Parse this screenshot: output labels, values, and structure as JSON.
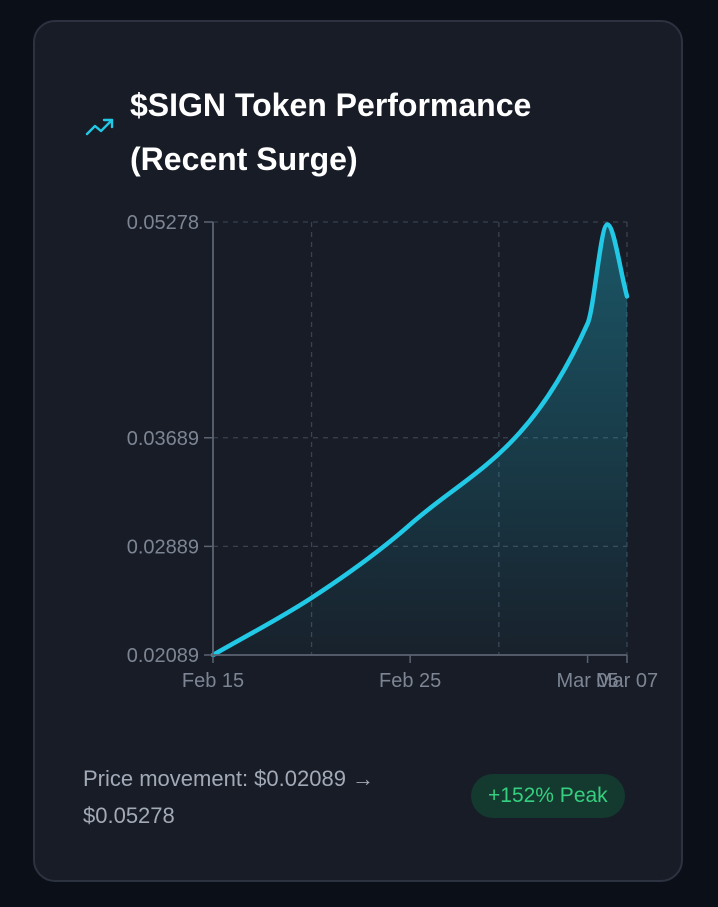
{
  "card": {
    "title": "$SIGN Token Performance (Recent Surge)",
    "title_icon": "trending-up-icon",
    "footer": {
      "price_movement": "Price movement: $0.02089 → $0.05278",
      "badge": "+152% Peak"
    }
  },
  "colors": {
    "background": "#0b0f17",
    "card": "#171c26",
    "line": "#22c9e6",
    "badge_text": "#35d07f",
    "badge_bg": "#14392f",
    "axis_text": "#7d8594"
  },
  "chart_data": {
    "type": "area",
    "title": "$SIGN Token Performance (Recent Surge)",
    "xlabel": "",
    "ylabel": "",
    "x_ticks": [
      "Feb 15",
      "Feb 25",
      "Mar 05",
      "Mar 07"
    ],
    "y_ticks": [
      "0.02089",
      "0.02889",
      "0.03689",
      "0.05278"
    ],
    "y_tick_values": [
      0.02089,
      0.02889,
      0.03689,
      0.05278
    ],
    "ylim": [
      0.02089,
      0.05278
    ],
    "grid": true,
    "series": [
      {
        "points": [
          {
            "x": "Feb 15",
            "y": 0.02089
          },
          {
            "x": "Feb 20",
            "y": 0.0251
          },
          {
            "x": "Feb 25",
            "y": 0.0305
          },
          {
            "x": "Mar 05",
            "y": 0.0453
          },
          {
            "x": "Mar 06",
            "y": 0.0526
          },
          {
            "x": "Mar 07",
            "y": 0.0473
          }
        ]
      }
    ]
  }
}
